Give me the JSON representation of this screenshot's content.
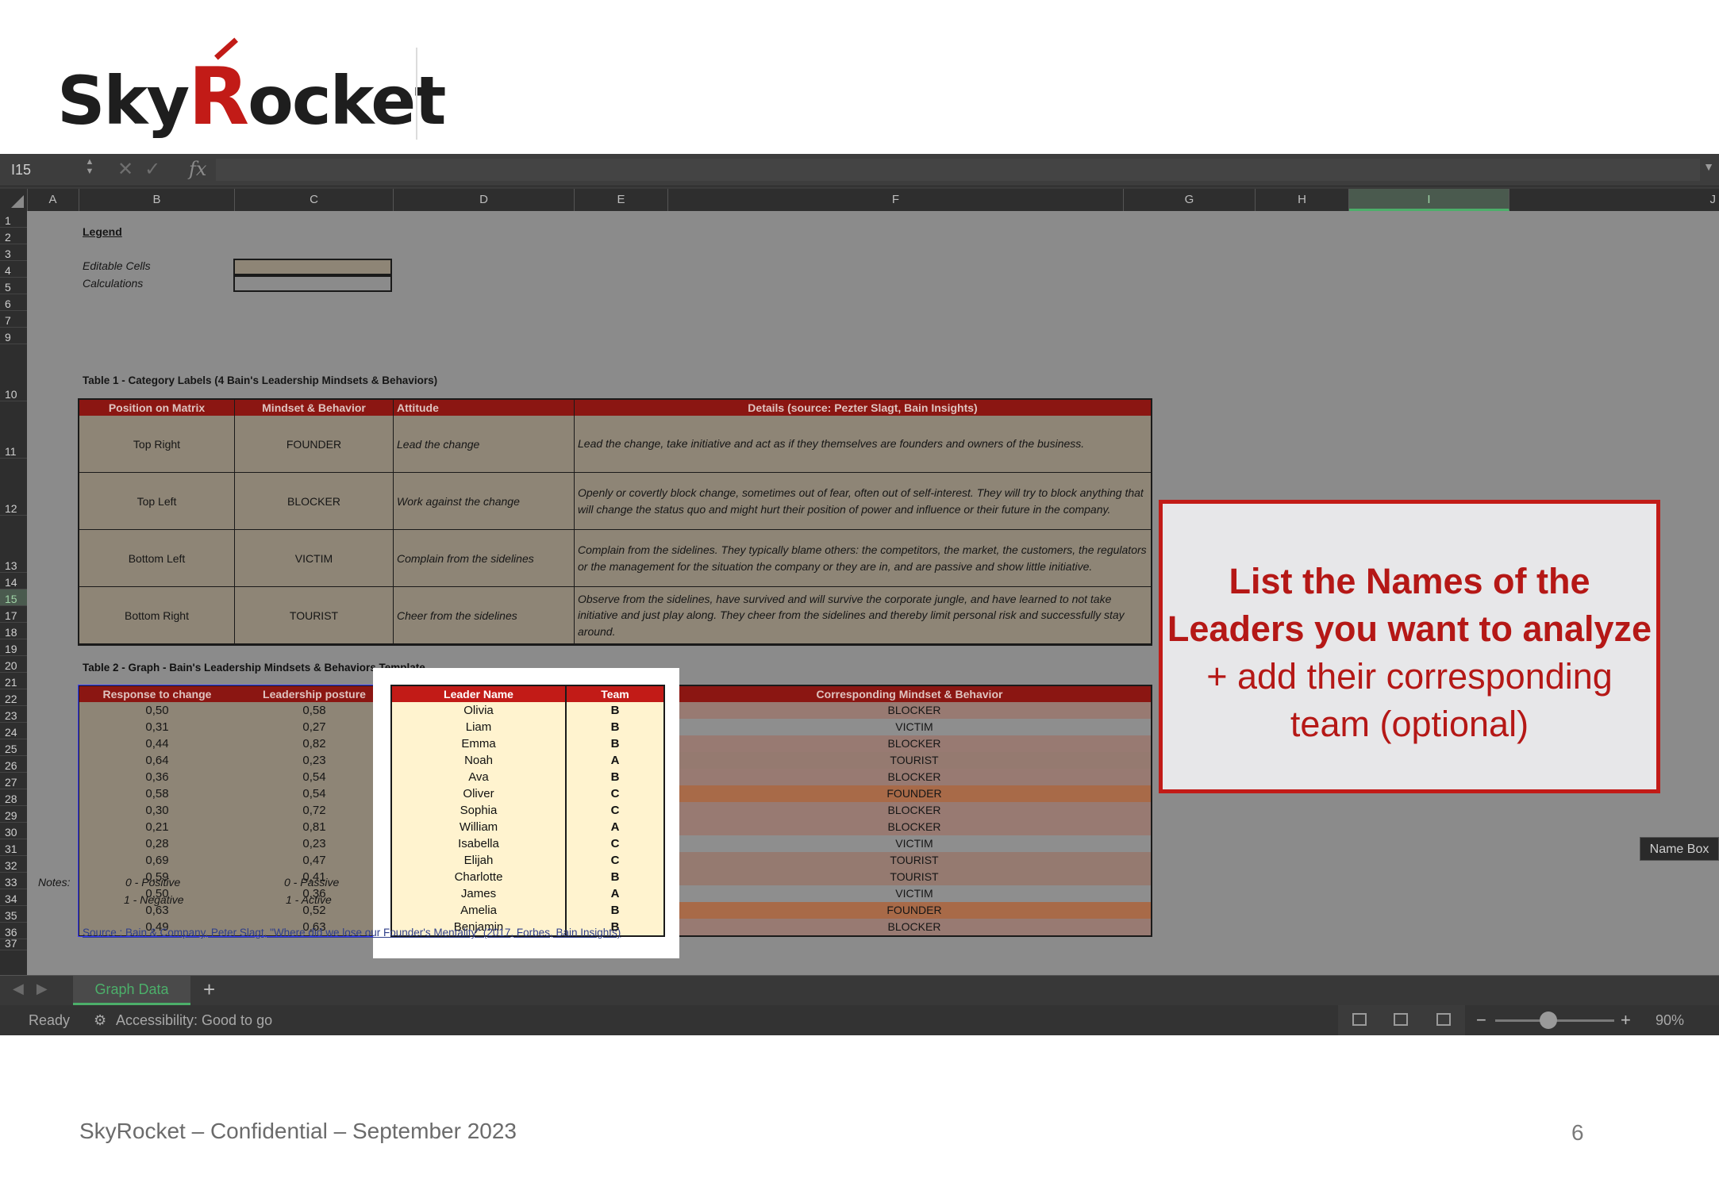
{
  "brand": {
    "logo_pre": "Sky",
    "logo_r": "R",
    "logo_post": "ocket"
  },
  "excel": {
    "name_box": "I15",
    "columns": [
      "A",
      "B",
      "C",
      "D",
      "E",
      "F",
      "G",
      "H",
      "I",
      "J"
    ],
    "rows": [
      "1",
      "2",
      "3",
      "4",
      "5",
      "6",
      "7",
      "9",
      "10",
      "11",
      "12",
      "13",
      "14",
      "15",
      "17",
      "18",
      "19",
      "20",
      "21",
      "22",
      "23",
      "24",
      "25",
      "26",
      "27",
      "28",
      "29",
      "30",
      "31",
      "32",
      "33",
      "34",
      "35",
      "36",
      "37"
    ],
    "legend": {
      "title": "Legend",
      "editable": "Editable Cells",
      "calculations": "Calculations"
    },
    "table1": {
      "title": "Table 1 - Category Labels (4 Bain's Leadership Mindsets & Behaviors)",
      "headers": [
        "Position on Matrix",
        "Mindset & Behavior",
        "Attitude",
        "Details (source: Pezter Slagt, Bain Insights)"
      ],
      "rows": [
        [
          "Top Right",
          "FOUNDER",
          "Lead the change",
          "Lead the change, take initiative and act as if they themselves are founders and owners of the business."
        ],
        [
          "Top Left",
          "BLOCKER",
          "Work against the change",
          "Openly or covertly block change, sometimes out of fear, often out of self-interest. They will try to block anything that will change the status quo and might hurt their position of power and influence or their future in the company."
        ],
        [
          "Bottom Left",
          "VICTIM",
          "Complain from the sidelines",
          "Complain from the sidelines. They typically blame others: the competitors, the market, the customers, the regulators or the management for the situation the company or they are in, and are passive and show little initiative."
        ],
        [
          "Bottom Right",
          "TOURIST",
          "Cheer from the sidelines",
          "Observe from the sidelines, have survived and will survive the corporate jungle, and have learned to not take initiative and just play along. They cheer from the sidelines and thereby limit personal risk and successfully stay around."
        ]
      ]
    },
    "table2": {
      "title": "Table 2 - Graph - Bain's Leadership Mindsets & Behaviors Template",
      "headers": [
        "Response to change",
        "Leadership posture",
        "Leader Name",
        "Team",
        "Corresponding Mindset & Behavior"
      ],
      "rows": [
        [
          "0,50",
          "0,58",
          "Olivia",
          "B",
          "BLOCKER"
        ],
        [
          "0,31",
          "0,27",
          "Liam",
          "B",
          "VICTIM"
        ],
        [
          "0,44",
          "0,82",
          "Emma",
          "B",
          "BLOCKER"
        ],
        [
          "0,64",
          "0,23",
          "Noah",
          "A",
          "TOURIST"
        ],
        [
          "0,36",
          "0,54",
          "Ava",
          "B",
          "BLOCKER"
        ],
        [
          "0,58",
          "0,54",
          "Oliver",
          "C",
          "FOUNDER"
        ],
        [
          "0,30",
          "0,72",
          "Sophia",
          "C",
          "BLOCKER"
        ],
        [
          "0,21",
          "0,81",
          "William",
          "A",
          "BLOCKER"
        ],
        [
          "0,28",
          "0,23",
          "Isabella",
          "C",
          "VICTIM"
        ],
        [
          "0,69",
          "0,47",
          "Elijah",
          "C",
          "TOURIST"
        ],
        [
          "0,59",
          "0,41",
          "Charlotte",
          "B",
          "TOURIST"
        ],
        [
          "0,50",
          "0,36",
          "James",
          "A",
          "VICTIM"
        ],
        [
          "0,63",
          "0,52",
          "Amelia",
          "B",
          "FOUNDER"
        ],
        [
          "0,49",
          "0,63",
          "Benjamin",
          "B",
          "BLOCKER"
        ]
      ],
      "mindset_colors": {
        "BLOCKER": "#987a72",
        "VICTIM": "#8e8e8e",
        "TOURIST": "#957a70",
        "FOUNDER": "#a86a48"
      }
    },
    "notes": {
      "label": "Notes:",
      "b1": "0 - Positive",
      "b2": "1 - Negative",
      "c1": "0 - Passive",
      "c2": "1 - Active"
    },
    "source": "Source : Bain & Company, Peter Slagt, \"Where did we lose our Founder's Mentality\" (2017, Forbes, Bain Insights)",
    "sheet_tab": "Graph Data",
    "add_sheet": "+",
    "status": {
      "ready": "Ready",
      "accessibility": "Accessibility: Good to go",
      "zoom": "90%",
      "minus": "−",
      "plus": "+"
    },
    "tooltip": "Name Box"
  },
  "callout": {
    "line1": "List the Names of the",
    "line2": "Leaders you want to analyze",
    "line3": "+ add their corresponding",
    "line4": "team (optional)"
  },
  "footer": {
    "text": "SkyRocket – Confidential – September 2023",
    "page": "6"
  },
  "colors": {
    "accent": "#c21b17",
    "header_red": "#8b1612"
  }
}
